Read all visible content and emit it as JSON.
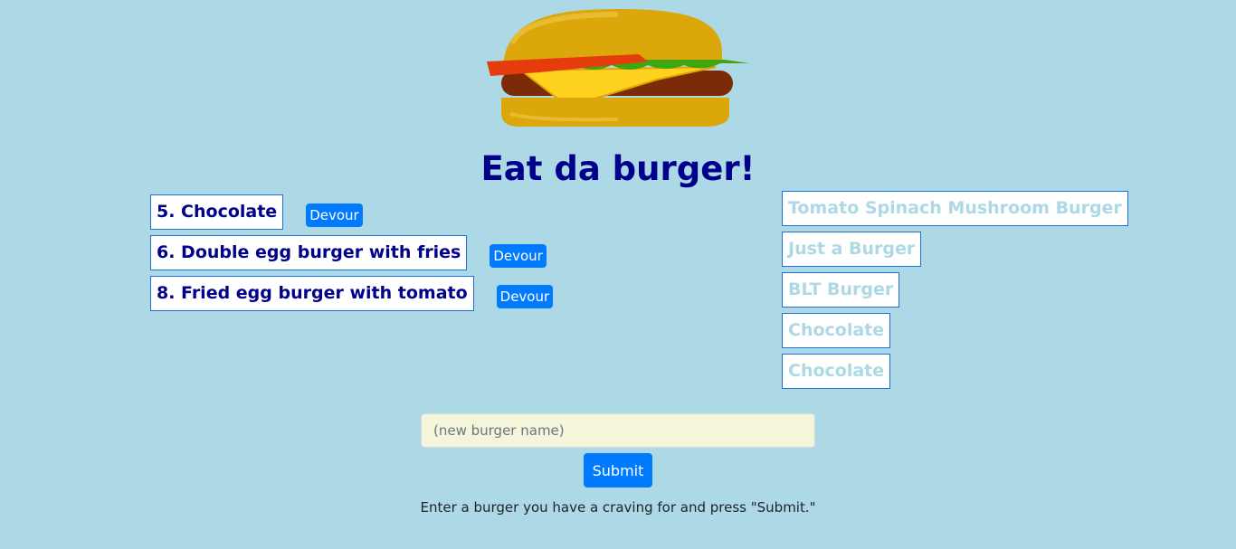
{
  "page": {
    "title": "Eat da burger!"
  },
  "uneaten": [
    {
      "label": "5. Chocolate",
      "button": "Devour"
    },
    {
      "label": "6. Double egg burger with fries",
      "button": "Devour"
    },
    {
      "label": "8. Fried egg burger with tomato",
      "button": "Devour"
    }
  ],
  "devoured": [
    {
      "label": "Tomato Spinach Mushroom Burger"
    },
    {
      "label": "Just a Burger"
    },
    {
      "label": "BLT Burger"
    },
    {
      "label": "Chocolate"
    },
    {
      "label": "Chocolate"
    }
  ],
  "form": {
    "placeholder": "(new burger name)",
    "value": "",
    "submit_label": "Submit",
    "hint": "Enter a burger you have a craving for and press \"Submit.\""
  },
  "colors": {
    "background": "#add8e6",
    "title": "#00008b",
    "button": "#007bff",
    "input_bg": "#f5f5dc"
  },
  "logo": {
    "icon": "burger-icon"
  }
}
